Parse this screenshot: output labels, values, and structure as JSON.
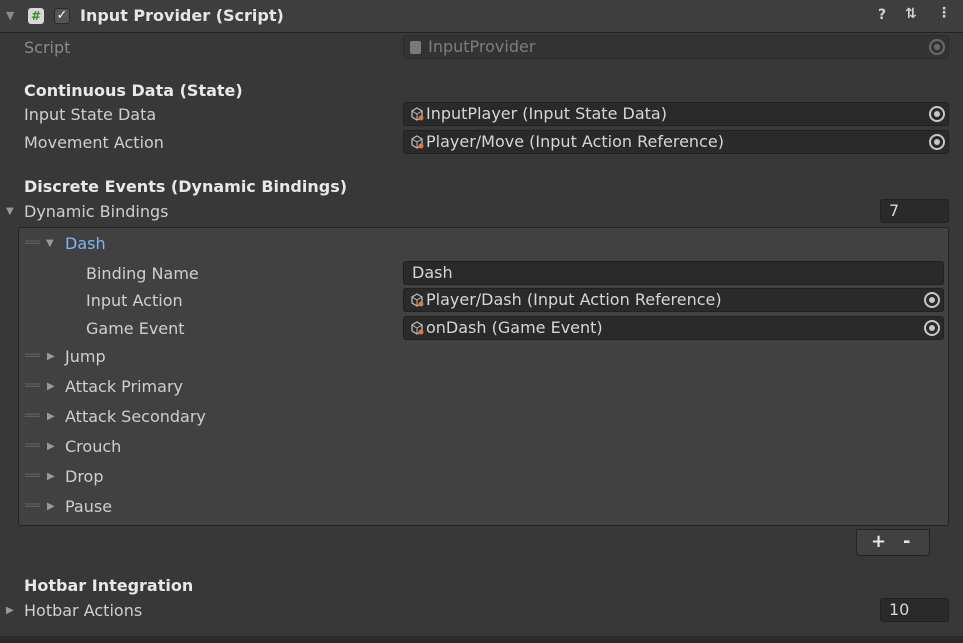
{
  "header": {
    "enabled_check": "✓",
    "script_icon": "#",
    "title": "Input Provider (Script)",
    "icons": [
      "help-icon",
      "presets-icon",
      "more-icon"
    ]
  },
  "script_row": {
    "label": "Script",
    "value": "InputProvider"
  },
  "continuous": {
    "heading": "Continuous Data (State)",
    "input_state_label": "Input State Data",
    "input_state_value": "InputPlayer (Input State Data)",
    "movement_label": "Movement Action",
    "movement_value": "Player/Move (Input Action Reference)"
  },
  "discrete": {
    "heading": "Discrete Events (Dynamic Bindings)",
    "dynamic_label": "Dynamic Bindings",
    "dynamic_count": "7",
    "expanded": {
      "label": "Dash",
      "binding_name_label": "Binding Name",
      "binding_name_value": "Dash",
      "input_action_label": "Input Action",
      "input_action_value": "Player/Dash (Input Action Reference)",
      "game_event_label": "Game Event",
      "game_event_value": "onDash (Game Event)"
    },
    "items": [
      "Jump",
      "Attack Primary",
      "Attack Secondary",
      "Crouch",
      "Drop",
      "Pause"
    ],
    "add_label": "+",
    "remove_label": "-"
  },
  "hotbar": {
    "heading": "Hotbar Integration",
    "actions_label": "Hotbar Actions",
    "actions_count": "10"
  },
  "colors": {
    "background": "#383838",
    "field": "#2a2a2a",
    "accent": "#7fb4f5"
  }
}
